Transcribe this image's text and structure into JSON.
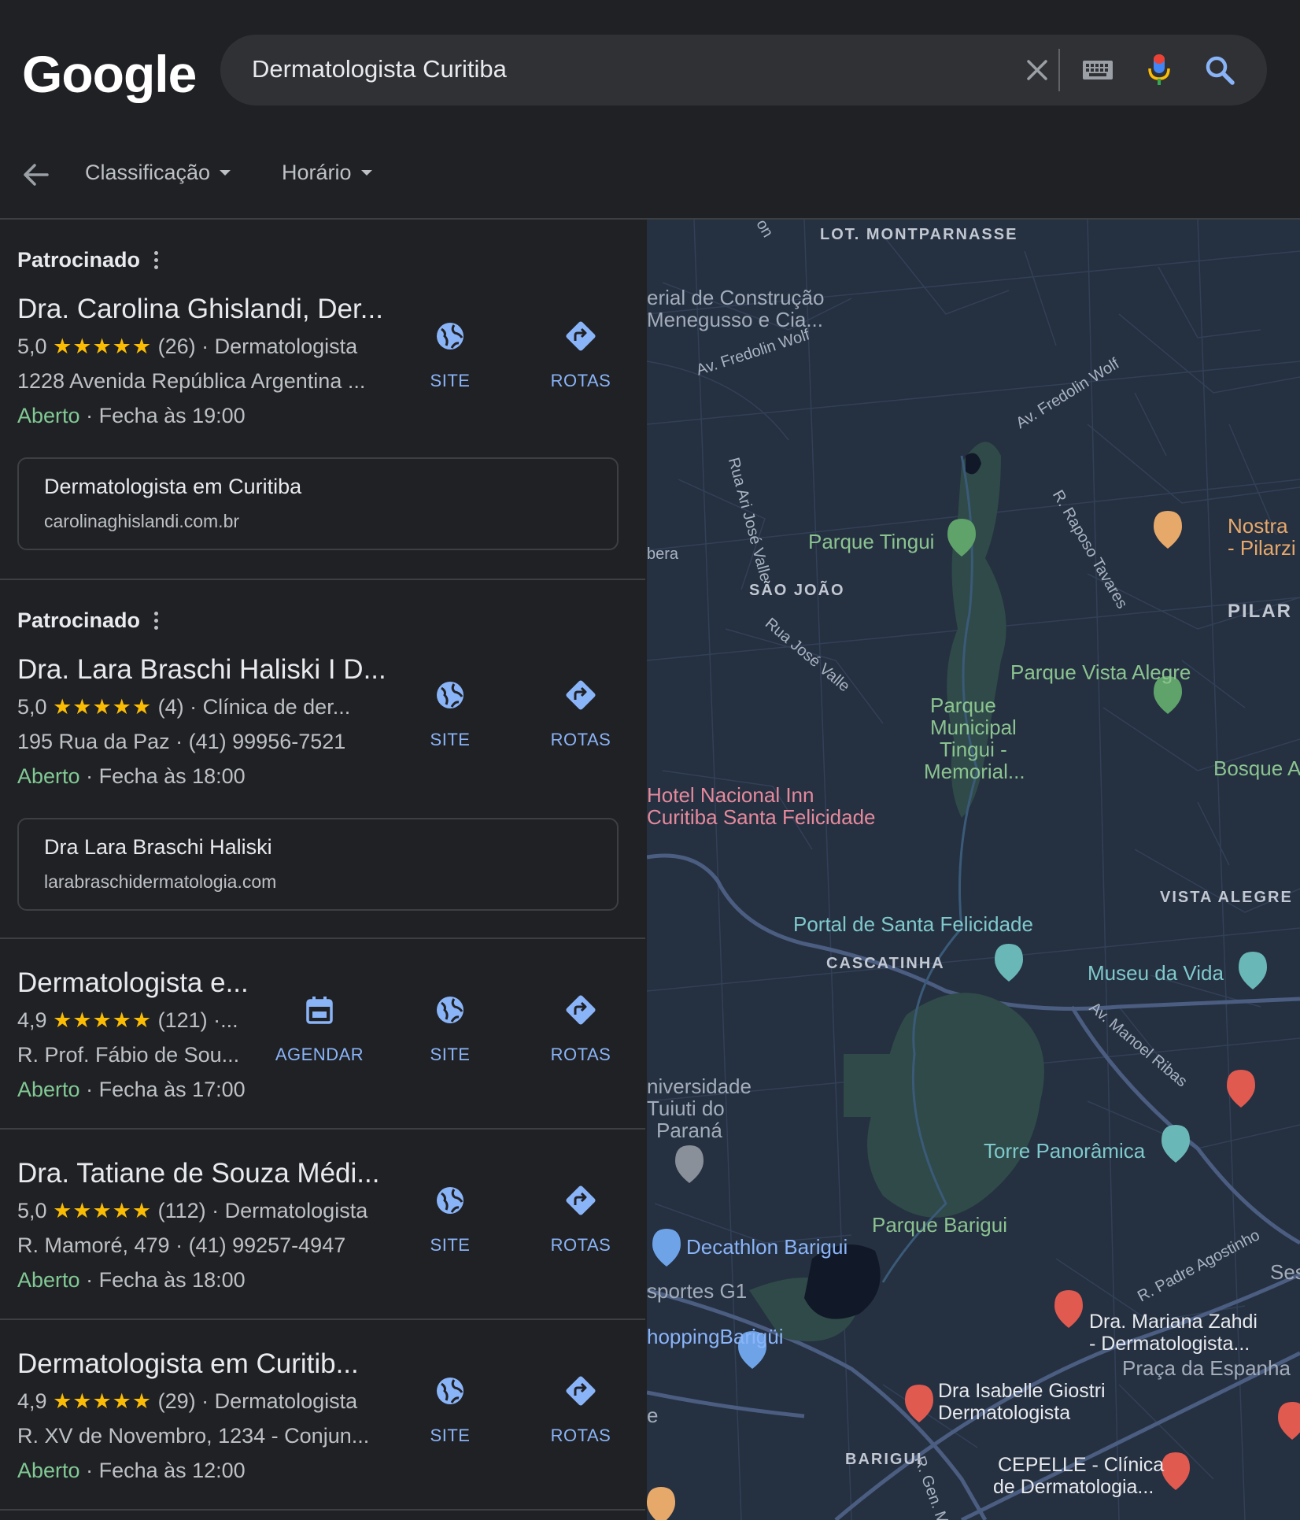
{
  "header": {
    "logo": "Google",
    "search_query": "Dermatologista Curitiba"
  },
  "filters": [
    {
      "label": "Classificação"
    },
    {
      "label": "Horário"
    }
  ],
  "colors": {
    "background": "#202124",
    "accent_blue": "#8ab4f8",
    "open_green": "#81c995",
    "star_yellow": "#fbbc04",
    "divider": "#3c4043"
  },
  "results": [
    {
      "sponsored_label": "Patrocinado",
      "title": "Dra. Carolina Ghislandi, Der...",
      "rating": "5,0",
      "stars": "★★★★★",
      "reviews_category": "(26) · Dermatologista",
      "address": "1228 Avenida República Argentina ...",
      "status": "Aberto",
      "hours": "· Fecha às 19:00",
      "ad": {
        "title": "Dermatologista em Curitiba",
        "url": "carolinaghislandi.com.br"
      },
      "actions": {
        "site": "SITE",
        "routes": "ROTAS"
      }
    },
    {
      "sponsored_label": "Patrocinado",
      "title": "Dra. Lara Braschi Haliski I D...",
      "rating": "5,0",
      "stars": "★★★★★",
      "reviews_category": "(4) · Clínica de der...",
      "address": "195 Rua da Paz · (41) 99956-7521",
      "status": "Aberto",
      "hours": "· Fecha às 18:00",
      "ad": {
        "title": "Dra Lara Braschi Haliski",
        "url": "larabraschidermatologia.com"
      },
      "actions": {
        "site": "SITE",
        "routes": "ROTAS"
      }
    },
    {
      "title": "Dermatologista e...",
      "rating": "4,9",
      "stars": "★★★★★",
      "reviews_category": "(121) ·...",
      "address": "R. Prof. Fábio de Sou...",
      "status": "Aberto",
      "hours": "· Fecha às 17:00",
      "actions": {
        "schedule": "AGENDAR",
        "site": "SITE",
        "routes": "ROTAS"
      }
    },
    {
      "title": "Dra. Tatiane de Souza Médi...",
      "rating": "5,0",
      "stars": "★★★★★",
      "reviews_category": "(112) · Dermatologista",
      "address": "R. Mamoré, 479 · (41) 99257-4947",
      "status": "Aberto",
      "hours": "· Fecha às 18:00",
      "actions": {
        "site": "SITE",
        "routes": "ROTAS"
      }
    },
    {
      "title": "Dermatologista em Curitib...",
      "rating": "4,9",
      "stars": "★★★★★",
      "reviews_category": "(29) · Dermatologista",
      "address": "R. XV de Novembro, 1234 - Conjun...",
      "status": "Aberto",
      "hours": "· Fecha às 12:00",
      "actions": {
        "site": "SITE",
        "routes": "ROTAS"
      }
    }
  ],
  "map": {
    "labels": {
      "montparnasse": "LOT. MONTPARNASSE",
      "material": "erial de Construção",
      "menegusso": "Menegusso e Cia...",
      "fredolin1": "Av. Fredolin Wolf",
      "fredolin2": "Av. Fredolin Wolf",
      "ari_jose": "Rua Ari José Valle",
      "raposo": "R. Raposo Tavares",
      "parque_tingui": "Parque Tingui",
      "nostra1": "Nostra",
      "nostra2": "- Pilarzi",
      "bera": "bera",
      "sao_joao": "SÃO JOÃO",
      "pilar": "PILAR",
      "rua_jose_valle": "Rua José Valle",
      "vista_alegre_park": "Parque Vista Alegre",
      "municipal1": "Parque",
      "municipal2": "Municipal",
      "municipal3": "Tingui -",
      "municipal4": "Memorial...",
      "bosque": "Bosque A",
      "hotel1": "Hotel Nacional Inn",
      "hotel2": "Curitiba Santa Felicidade",
      "vista_alegre": "VISTA ALEGRE",
      "portal": "Portal de Santa Felicidade",
      "cascatinha": "CASCATINHA",
      "museu": "Museu da Vida",
      "manoel": "Av. Manoel Ribas",
      "univ1": "niversidade",
      "univ2": "Tuiuti do",
      "univ3": "Paraná",
      "torre": "Torre Panorâmica",
      "barigui_park": "Parque Barigui",
      "decathlon": "Decathlon Barigui",
      "agostinho": "R. Padre Agostinho",
      "sesc": "Sesc",
      "esportes": "sportes G1",
      "shopping": "hoppingBarigüi",
      "mariana1": "Dra. Mariana Zahdi",
      "mariana2": "- Dermatologista...",
      "praca": "Praça da Espanha",
      "isabelle1": "Dra Isabelle Giostri",
      "isabelle2": "Dermatologista",
      "e": "e",
      "barigui": "BARIGUI",
      "gen": "R. Gen. Mári",
      "cepelle1": "CEPELLE - Clínica",
      "cepelle2": "de Dermatologia...",
      "on": "on"
    }
  }
}
